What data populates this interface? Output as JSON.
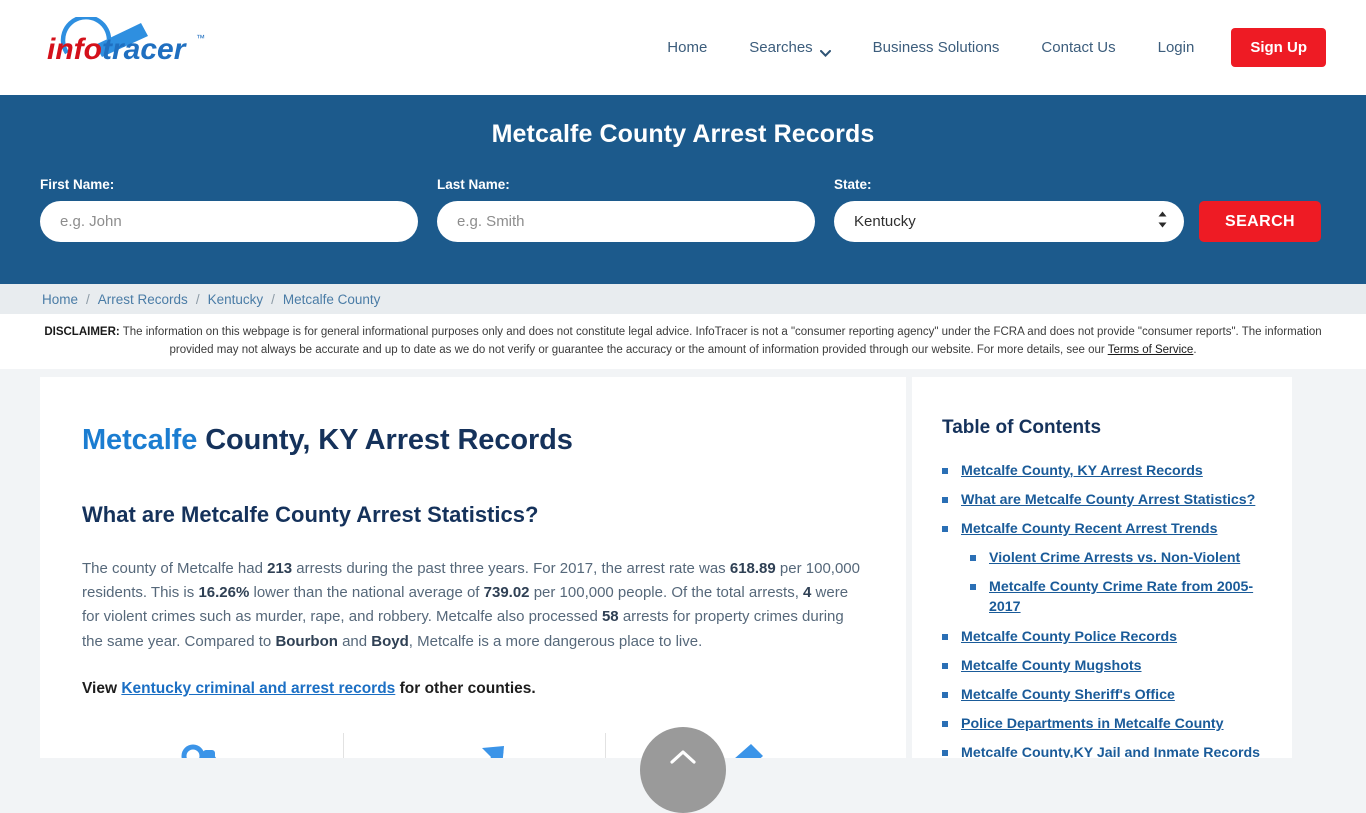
{
  "header": {
    "logo": {
      "name": "infotracer-logo",
      "text_red": "info",
      "text_blue": "tracer",
      "tm": "TM"
    },
    "nav": [
      {
        "label": "Home",
        "name": "nav-home"
      },
      {
        "label": "Searches",
        "name": "nav-searches",
        "has_caret": true
      },
      {
        "label": "Business Solutions",
        "name": "nav-business-solutions"
      },
      {
        "label": "Contact Us",
        "name": "nav-contact-us"
      },
      {
        "label": "Login",
        "name": "nav-login"
      }
    ],
    "signup_label": "Sign Up"
  },
  "hero": {
    "title": "Metcalfe County Arrest Records",
    "background_color": "#1c5a8c",
    "first_name": {
      "label": "First Name:",
      "value": "",
      "placeholder": "e.g. John"
    },
    "last_name": {
      "label": "Last Name:",
      "value": "",
      "placeholder": "e.g. Smith"
    },
    "state": {
      "label": "State:",
      "value": "Kentucky"
    },
    "search_label": "SEARCH"
  },
  "breadcrumb": {
    "items": [
      "Home",
      "Arrest Records",
      "Kentucky",
      "Metcalfe County"
    ],
    "separator": "/"
  },
  "disclaimer": {
    "label": "DISCLAIMER:",
    "text": " The information on this webpage is for general informational purposes only and does not constitute legal advice. InfoTracer is not a \"consumer reporting agency\" under the FCRA and does not provide \"consumer reports\". The information provided may not always be accurate and up to date as we do not verify or guarantee the accuracy or the amount of information provided through our website. For more details, see our ",
    "link": "Terms of Service",
    "period": "."
  },
  "main": {
    "title_accent": "Metcalfe",
    "title_rest": " County, KY Arrest Records",
    "subheading": "What are Metcalfe County Arrest Statistics?",
    "paragraph": {
      "p1": "The county of Metcalfe had ",
      "arrests": "213",
      "p2": " arrests during the past three years. For 2017, the arrest rate was ",
      "rate": "618.89",
      "p3": " per 100,000 residents. This is ",
      "pct": "16.26%",
      "p4": " lower than the national average of ",
      "national": "739.02",
      "p5": " per 100,000 people. Of the total arrests, ",
      "violent": "4",
      "p6": " were for violent crimes such as murder, rape, and robbery. Metcalfe also processed ",
      "property": "58",
      "p7": " arrests for property crimes during the same year. Compared to ",
      "county_a": "Bourbon",
      "p8": " and ",
      "county_b": "Boyd",
      "p9": ", Metcalfe is a more dangerous place to live."
    },
    "view_line": {
      "prefix": "View ",
      "link": "Kentucky criminal and arrest records",
      "suffix": " for other counties."
    },
    "icons": [
      {
        "name": "handcuffs-icon"
      },
      {
        "name": "trend-up-arrow-icon"
      },
      {
        "name": "pencil-icon"
      }
    ]
  },
  "toc": {
    "title": "Table of Contents",
    "items": [
      {
        "label": "Metcalfe County, KY Arrest Records",
        "sub": false
      },
      {
        "label": "What are Metcalfe County Arrest Statistics?",
        "sub": false
      },
      {
        "label": "Metcalfe County Recent Arrest Trends",
        "sub": false
      },
      {
        "label": "Violent Crime Arrests vs. Non-Violent",
        "sub": true
      },
      {
        "label": "Metcalfe County Crime Rate from 2005-2017",
        "sub": true
      },
      {
        "label": "Metcalfe County Police Records",
        "sub": false
      },
      {
        "label": "Metcalfe County Mugshots",
        "sub": false
      },
      {
        "label": "Metcalfe County Sheriff's Office",
        "sub": false
      },
      {
        "label": "Police Departments in Metcalfe County",
        "sub": false
      },
      {
        "label": "Metcalfe County,KY Jail and Inmate Records",
        "sub": false
      }
    ]
  },
  "scroll_top": {
    "name": "scroll-to-top-button",
    "color": "#9a9a9a"
  },
  "colors": {
    "brand_red": "#ee1b24",
    "hero_blue": "#1c5a8c",
    "link_blue": "#1a5b99",
    "accent_blue": "#1b7dd1"
  }
}
